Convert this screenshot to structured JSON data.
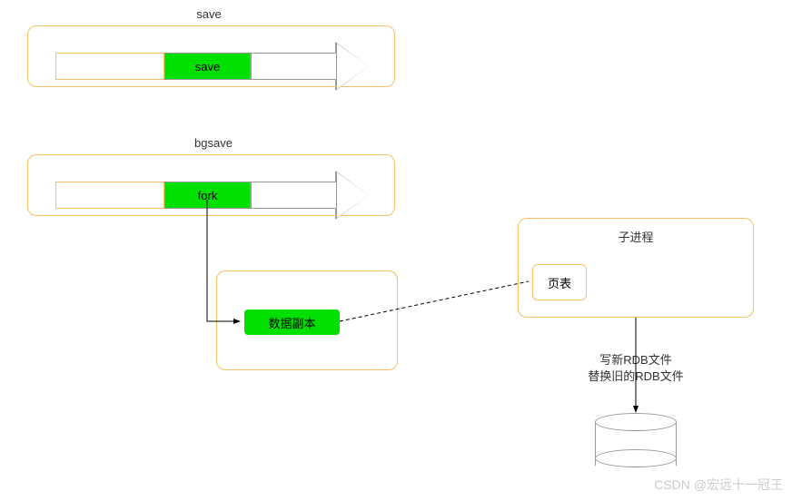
{
  "diagram": {
    "save_section": {
      "title": "save",
      "arrow_label": "save"
    },
    "bgsave_section": {
      "title": "bgsave",
      "arrow_label": "fork"
    },
    "data_copy_box": "数据副本",
    "child_process": {
      "title": "子进程",
      "page_table": "页表"
    },
    "rdb_annotation_line1": "写新RDB文件",
    "rdb_annotation_line2": "替换旧的RDB文件"
  },
  "watermark": "CSDN @宏远十一冠王"
}
